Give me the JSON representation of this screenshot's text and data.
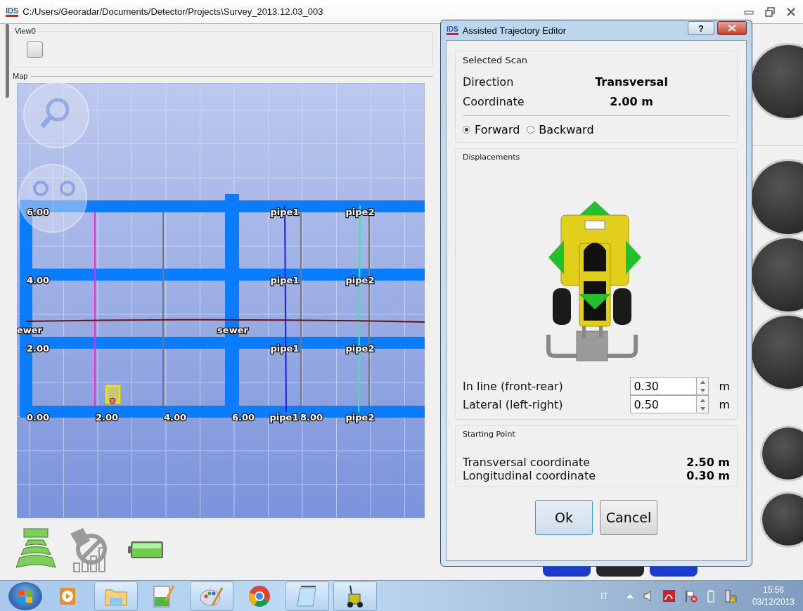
{
  "window": {
    "logo": "IDS",
    "title": "C:/Users/Georadar/Documents/Detector/Projects\\Survey_2013.12.03_003"
  },
  "view_panel": {
    "title": "View0"
  },
  "map_panel": {
    "title": "Map",
    "y_labels": [
      "6.00",
      "4.00",
      "2.00",
      "0.00"
    ],
    "x_labels": [
      "2.00",
      "4.00",
      "6.00",
      "8.00"
    ],
    "utilities": [
      {
        "kind": "pipe",
        "color": "#1a1ae8",
        "labels": [
          "pipe1",
          "pipe1",
          "pipe1",
          "pipe1"
        ]
      },
      {
        "kind": "pipe",
        "color": "#33ee99",
        "labels": [
          "pipe2",
          "pipe2",
          "pipe2",
          "pipe2"
        ]
      },
      {
        "kind": "sewer",
        "color": "#6b1010",
        "labels": [
          "ewer",
          "sewer"
        ]
      }
    ]
  },
  "dialog": {
    "logo": "IDS",
    "title": "Assisted Trajectory Editor",
    "help": "?",
    "selected_scan": {
      "title": "Selected Scan",
      "rows": [
        {
          "label": "Direction",
          "value": "Transversal"
        },
        {
          "label": "Coordinate",
          "value": "2.00 m"
        }
      ],
      "directions": [
        {
          "label": "Forward",
          "selected": true
        },
        {
          "label": "Backward",
          "selected": false
        }
      ]
    },
    "displacements": {
      "title": "Displacements",
      "fields": [
        {
          "label": "In line (front-rear)",
          "value": "0.30",
          "unit": "m"
        },
        {
          "label": "Lateral (left-right)",
          "value": "0.50",
          "unit": "m"
        }
      ]
    },
    "starting_point": {
      "title": "Starting Point",
      "rows": [
        {
          "label": "Transversal coordinate",
          "value": "2.50 m"
        },
        {
          "label": "Longitudinal coordinate",
          "value": "0.30 m"
        }
      ]
    },
    "buttons": [
      {
        "label": "Ok",
        "default": true
      },
      {
        "label": "Cancel",
        "default": false
      }
    ]
  },
  "taskbar": {
    "apps": [
      {
        "kind": "media",
        "open": false
      },
      {
        "kind": "folder",
        "open": true
      },
      {
        "kind": "editor",
        "open": false
      },
      {
        "kind": "palette",
        "open": true
      },
      {
        "kind": "browser",
        "open": false
      },
      {
        "kind": "notepad",
        "open": true
      },
      {
        "kind": "cart",
        "open": true
      }
    ],
    "language": "IT",
    "time": "15:56",
    "date": "03/12/2013"
  }
}
